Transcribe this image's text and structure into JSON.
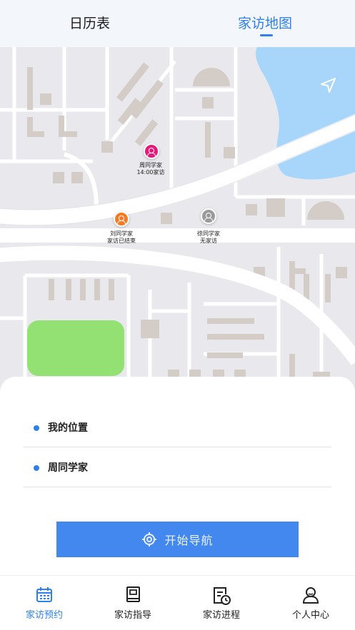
{
  "tabs": [
    {
      "label": "日历表",
      "active": false
    },
    {
      "label": "家访地图",
      "active": true
    }
  ],
  "map": {
    "markers": [
      {
        "name": "周同学家",
        "status": "14:00家访",
        "color": "#e8177a"
      },
      {
        "name": "刘同学家",
        "status": "家访已结束",
        "color": "#f47a26"
      },
      {
        "name": "徐同学家",
        "status": "无家访",
        "color": "#9a9a9a"
      }
    ],
    "icons": {
      "locate": "location-arrow-icon"
    }
  },
  "route": {
    "origin": "我的位置",
    "destination": "周同学家"
  },
  "navigate_button": {
    "label": "开始导航",
    "icon": "target-icon"
  },
  "tabbar": [
    {
      "label": "家访预约",
      "icon": "calendar-icon",
      "active": true
    },
    {
      "label": "家访指导",
      "icon": "book-icon",
      "active": false
    },
    {
      "label": "家访进程",
      "icon": "document-clock-icon",
      "active": false
    },
    {
      "label": "个人中心",
      "icon": "user-icon",
      "active": false
    }
  ],
  "colors": {
    "accent": "#2f80ed",
    "button": "#4388ee",
    "water": "#a7d6fa",
    "park": "#93e172"
  }
}
